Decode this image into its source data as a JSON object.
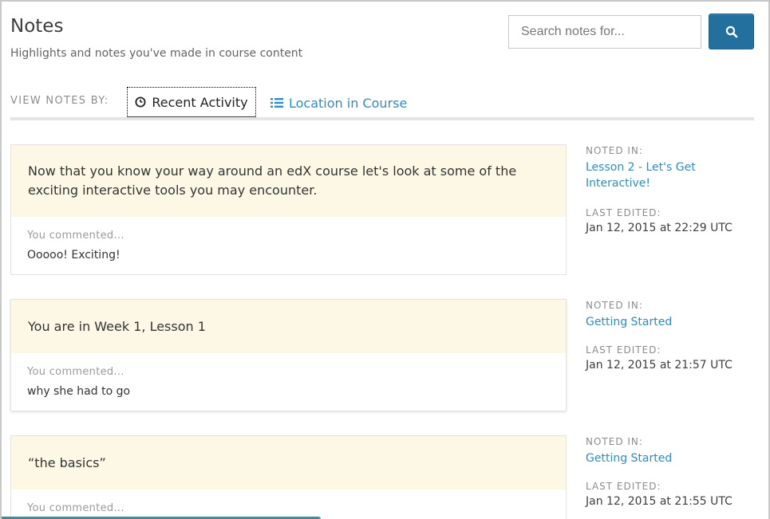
{
  "header": {
    "title": "Notes",
    "subtitle": "Highlights and notes you've made in course content"
  },
  "search": {
    "placeholder": "Search notes for...",
    "button_icon": "search-icon"
  },
  "view_by": {
    "label": "VIEW NOTES BY:",
    "tabs": [
      {
        "label": "Recent Activity",
        "icon": "clock-icon",
        "active": true
      },
      {
        "label": "Location in Course",
        "icon": "list-icon",
        "active": false
      }
    ]
  },
  "notes": [
    {
      "excerpt": "Now that you know your way around an edX course let's look at some of the exciting interactive tools you may encounter.",
      "comment_label": "You commented...",
      "comment": "Ooooo! Exciting!",
      "noted_in_label": "NOTED IN:",
      "noted_in": "Lesson 2 - Let's Get Interactive!",
      "last_edited_label": "LAST EDITED:",
      "last_edited": "Jan 12, 2015 at 22:29 UTC"
    },
    {
      "excerpt": "You are in Week 1, Lesson 1",
      "comment_label": "You commented...",
      "comment": "why she had to go",
      "noted_in_label": "NOTED IN:",
      "noted_in": "Getting Started",
      "last_edited_label": "LAST EDITED:",
      "last_edited": "Jan 12, 2015 at 21:57 UTC"
    },
    {
      "excerpt": "“the basics”",
      "comment_label": "You commented...",
      "comment": "",
      "noted_in_label": "NOTED IN:",
      "noted_in": "Getting Started",
      "last_edited_label": "LAST EDITED:",
      "last_edited": "Jan 12, 2015 at 21:55 UTC"
    }
  ],
  "colors": {
    "accent": "#236f9e",
    "link": "#2f8cc4",
    "highlight": "#fdf8e5"
  }
}
